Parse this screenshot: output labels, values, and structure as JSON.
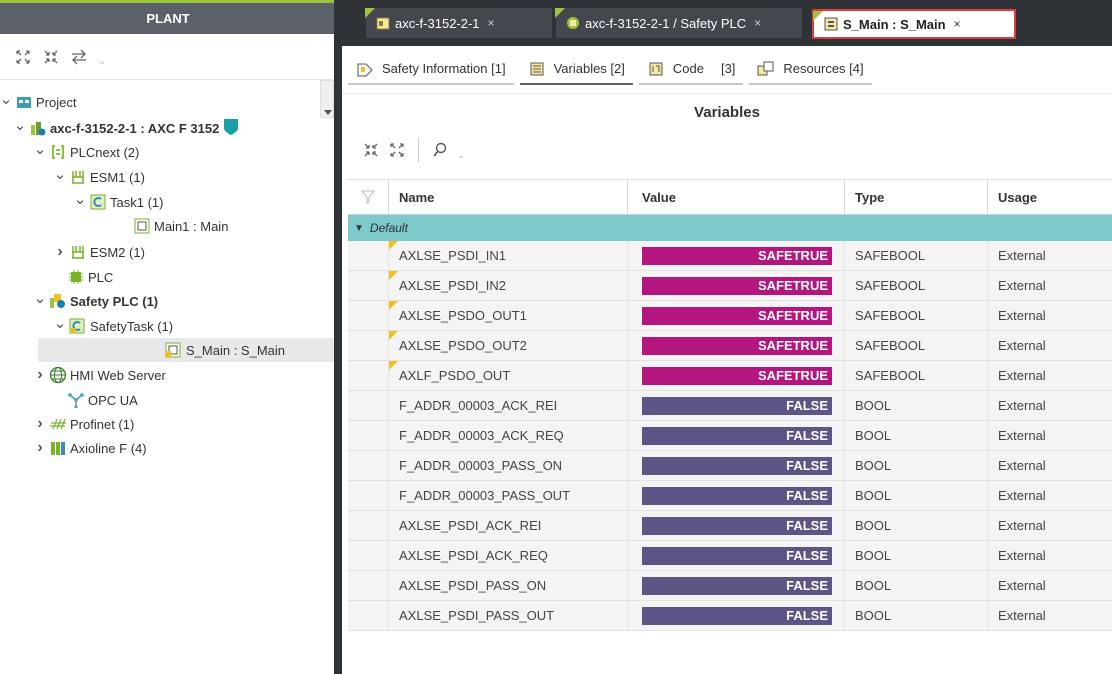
{
  "plant": {
    "title": "PLANT",
    "tree": [
      {
        "label": "Project",
        "toggle": "down",
        "icon": "project-icon"
      },
      {
        "label": "axc-f-3152-2-1 : AXC F 3152",
        "toggle": "down",
        "icon": "controller-icon",
        "bold": true
      },
      {
        "label": "PLCnext (2)",
        "toggle": "down",
        "icon": "plcnext-icon"
      },
      {
        "label": "ESM1 (1)",
        "toggle": "down",
        "icon": "esm-icon"
      },
      {
        "label": "Task1 (1)",
        "toggle": "down",
        "icon": "task-icon"
      },
      {
        "label": "Main1 : Main",
        "toggle": "",
        "icon": "program-icon"
      },
      {
        "label": "ESM2 (1)",
        "toggle": "right",
        "icon": "esm-icon"
      },
      {
        "label": "PLC",
        "toggle": "",
        "icon": "plc-chip-icon"
      },
      {
        "label": "Safety PLC (1)",
        "toggle": "down",
        "icon": "safety-plc-icon",
        "bold": true
      },
      {
        "label": "SafetyTask (1)",
        "toggle": "down",
        "icon": "safety-task-icon"
      },
      {
        "label": "S_Main : S_Main",
        "toggle": "",
        "icon": "safety-program-icon",
        "selected": true
      },
      {
        "label": "HMI Web Server",
        "toggle": "right",
        "icon": "globe-icon"
      },
      {
        "label": "OPC UA",
        "toggle": "",
        "icon": "opcua-icon"
      },
      {
        "label": "Profinet (1)",
        "toggle": "right",
        "icon": "profinet-icon"
      },
      {
        "label": "Axioline F (4)",
        "toggle": "right",
        "icon": "axioline-icon"
      }
    ]
  },
  "tabs": [
    {
      "label": "axc-f-3152-2-1",
      "close": "×"
    },
    {
      "label": "axc-f-3152-2-1 / Safety PLC",
      "close": "×"
    },
    {
      "label": "S_Main : S_Main",
      "close": "×"
    }
  ],
  "subtabs": [
    {
      "label": "Safety Information [1]"
    },
    {
      "label": "Variables [2]"
    },
    {
      "label": "Code",
      "suffix": "[3]"
    },
    {
      "label": "Resources [4]"
    }
  ],
  "variables": {
    "title": "Variables",
    "columns": [
      "Name",
      "Value",
      "Type",
      "Usage"
    ],
    "group": "Default",
    "rows": [
      {
        "name": "AXLSE_PSDI_IN1",
        "value": "SAFETRUE",
        "type": "SAFEBOOL",
        "usage": "External",
        "flag": true
      },
      {
        "name": "AXLSE_PSDI_IN2",
        "value": "SAFETRUE",
        "type": "SAFEBOOL",
        "usage": "External",
        "flag": true
      },
      {
        "name": "AXLSE_PSDO_OUT1",
        "value": "SAFETRUE",
        "type": "SAFEBOOL",
        "usage": "External",
        "flag": true
      },
      {
        "name": "AXLSE_PSDO_OUT2",
        "value": "SAFETRUE",
        "type": "SAFEBOOL",
        "usage": "External",
        "flag": true
      },
      {
        "name": "AXLF_PSDO_OUT",
        "value": "SAFETRUE",
        "type": "SAFEBOOL",
        "usage": "External",
        "flag": true
      },
      {
        "name": "F_ADDR_00003_ACK_REI",
        "value": "FALSE",
        "type": "BOOL",
        "usage": "External",
        "flag": false
      },
      {
        "name": "F_ADDR_00003_ACK_REQ",
        "value": "FALSE",
        "type": "BOOL",
        "usage": "External",
        "flag": false
      },
      {
        "name": "F_ADDR_00003_PASS_ON",
        "value": "FALSE",
        "type": "BOOL",
        "usage": "External",
        "flag": false
      },
      {
        "name": "F_ADDR_00003_PASS_OUT",
        "value": "FALSE",
        "type": "BOOL",
        "usage": "External",
        "flag": false
      },
      {
        "name": "AXLSE_PSDI_ACK_REI",
        "value": "FALSE",
        "type": "BOOL",
        "usage": "External",
        "flag": false
      },
      {
        "name": "AXLSE_PSDI_ACK_REQ",
        "value": "FALSE",
        "type": "BOOL",
        "usage": "External",
        "flag": false
      },
      {
        "name": "AXLSE_PSDI_PASS_ON",
        "value": "FALSE",
        "type": "BOOL",
        "usage": "External",
        "flag": false
      },
      {
        "name": "AXLSE_PSDI_PASS_OUT",
        "value": "FALSE",
        "type": "BOOL",
        "usage": "External",
        "flag": false
      }
    ]
  },
  "colors": {
    "safetrue": "#b3177f",
    "false": "#5e5485",
    "group_row": "#7ec9cc",
    "accent_green": "#9bc53d",
    "active_tab_border": "#e23b3b"
  }
}
